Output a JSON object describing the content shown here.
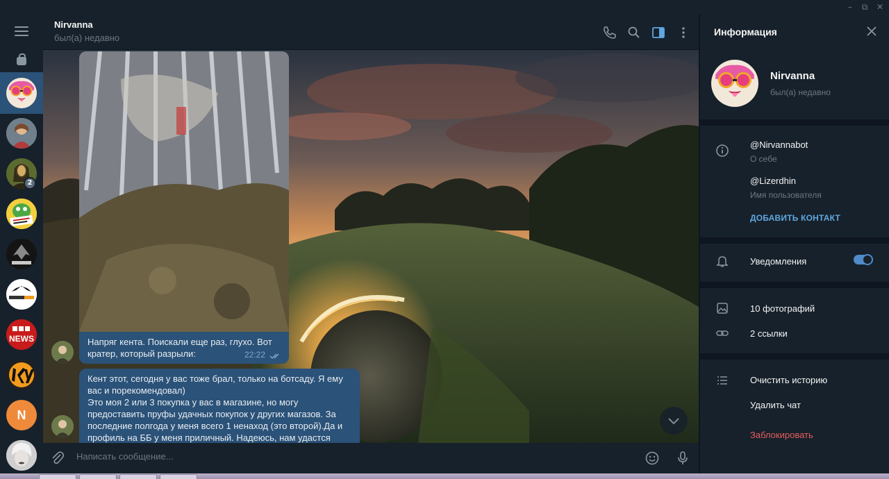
{
  "window": {
    "minimize": "–",
    "restore": "⧉",
    "close": "✕"
  },
  "sidebar": {
    "chats": [
      {
        "name": "chat-nirvanna",
        "active": true
      },
      {
        "name": "chat-2"
      },
      {
        "name": "chat-monalisa",
        "badge": "2"
      },
      {
        "name": "chat-green-avatar"
      },
      {
        "name": "chat-corona"
      },
      {
        "name": "chat-history-porn"
      },
      {
        "name": "chat-bbc-news"
      },
      {
        "name": "chat-ky"
      },
      {
        "name": "chat-n",
        "initial": "N"
      },
      {
        "name": "chat-marilyn"
      }
    ]
  },
  "header": {
    "name": "Nirvanna",
    "status": "был(а) недавно"
  },
  "messages": {
    "m1": {
      "text": "Напряг кента. Поискали еще раз, глухо. Вот кратер, который разрыли:",
      "time": "22:22"
    },
    "m2": {
      "lines": [
        "Кент этот, сегодня у вас тоже брал, только на ботсаду. Я ему вас и порекомендовал)",
        "Это моя 2 или 3 покупка у вас в магазине, но могу предоставить пруфы удачных покупок у других магазов. За последние полгода у меня всего 1 ненаход (это второй).Да и профиль на ББ у меня приличный. Надеюсь, нам удастся решить эту"
      ]
    }
  },
  "composer": {
    "placeholder": "Написать сообщение..."
  },
  "info": {
    "title": "Информация",
    "name": "Nirvanna",
    "status": "был(а) недавно",
    "bio": "@Nirvannabot",
    "bio_label": "О себе",
    "username": "@Lizerdhin",
    "username_label": "Имя пользователя",
    "add_contact": "ДОБАВИТЬ КОНТАКТ",
    "notifications": "Уведомления",
    "notifications_on": true,
    "photos": "10 фотографий",
    "links": "2 ссылки",
    "clear_history": "Очистить историю",
    "delete_chat": "Удалить чат",
    "block": "Заблокировать"
  },
  "colors": {
    "bg": "#17212b",
    "active": "#2b5278",
    "accent": "#5fa7e0",
    "danger": "#e55d5d",
    "muted": "#6c7883"
  }
}
